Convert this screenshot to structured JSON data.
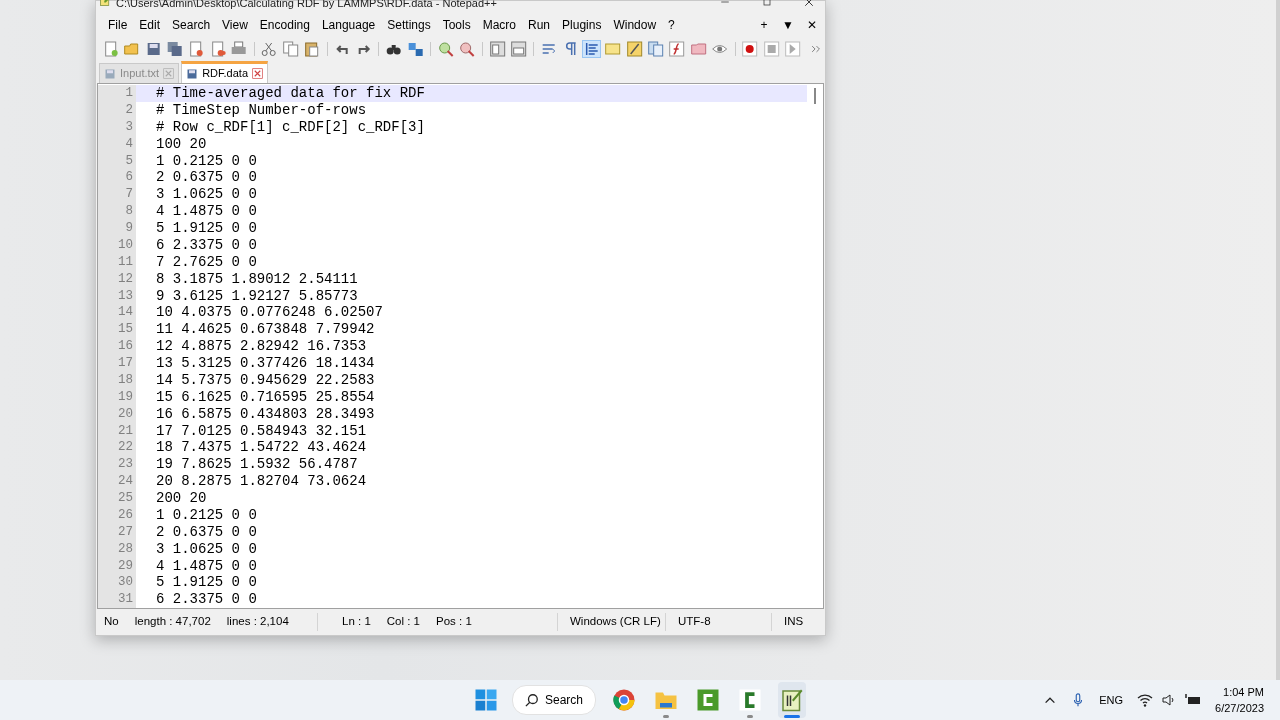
{
  "window": {
    "title": "C:\\Users\\Admin\\Desktop\\Calculating RDF by LAMMPS\\RDF.data - Notepad++",
    "menu": [
      "File",
      "Edit",
      "Search",
      "View",
      "Encoding",
      "Language",
      "Settings",
      "Tools",
      "Macro",
      "Run",
      "Plugins",
      "Window",
      "?"
    ],
    "menu_right": [
      "+",
      "▼",
      "✕"
    ]
  },
  "toolbar": {
    "indent_guide_on": true
  },
  "tabs": [
    {
      "label": "Input.txt",
      "selected": false
    },
    {
      "label": "RDF.data",
      "selected": true
    }
  ],
  "editor": {
    "lines": [
      {
        "number": "1",
        "text": "# Time-averaged data for fix RDF",
        "current": true
      },
      {
        "number": "2",
        "text": "# TimeStep Number-of-rows",
        "current": false
      },
      {
        "number": "3",
        "text": "# Row c_RDF[1] c_RDF[2] c_RDF[3]",
        "current": false
      },
      {
        "number": "4",
        "text": "100 20",
        "current": false
      },
      {
        "number": "5",
        "text": "1 0.2125 0 0",
        "current": false
      },
      {
        "number": "6",
        "text": "2 0.6375 0 0",
        "current": false
      },
      {
        "number": "7",
        "text": "3 1.0625 0 0",
        "current": false
      },
      {
        "number": "8",
        "text": "4 1.4875 0 0",
        "current": false
      },
      {
        "number": "9",
        "text": "5 1.9125 0 0",
        "current": false
      },
      {
        "number": "10",
        "text": "6 2.3375 0 0",
        "current": false
      },
      {
        "number": "11",
        "text": "7 2.7625 0 0",
        "current": false
      },
      {
        "number": "12",
        "text": "8 3.1875 1.89012 2.54111",
        "current": false
      },
      {
        "number": "13",
        "text": "9 3.6125 1.92127 5.85773",
        "current": false
      },
      {
        "number": "14",
        "text": "10 4.0375 0.0776248 6.02507",
        "current": false
      },
      {
        "number": "15",
        "text": "11 4.4625 0.673848 7.79942",
        "current": false
      },
      {
        "number": "16",
        "text": "12 4.8875 2.82942 16.7353",
        "current": false
      },
      {
        "number": "17",
        "text": "13 5.3125 0.377426 18.1434",
        "current": false
      },
      {
        "number": "18",
        "text": "14 5.7375 0.945629 22.2583",
        "current": false
      },
      {
        "number": "19",
        "text": "15 6.1625 0.716595 25.8554",
        "current": false
      },
      {
        "number": "20",
        "text": "16 6.5875 0.434803 28.3493",
        "current": false
      },
      {
        "number": "21",
        "text": "17 7.0125 0.584943 32.151",
        "current": false
      },
      {
        "number": "22",
        "text": "18 7.4375 1.54722 43.4624",
        "current": false
      },
      {
        "number": "23",
        "text": "19 7.8625 1.5932 56.4787",
        "current": false
      },
      {
        "number": "24",
        "text": "20 8.2875 1.82704 73.0624",
        "current": false
      },
      {
        "number": "25",
        "text": "200 20",
        "current": false
      },
      {
        "number": "26",
        "text": "1 0.2125 0 0",
        "current": false
      },
      {
        "number": "27",
        "text": "2 0.6375 0 0",
        "current": false
      },
      {
        "number": "28",
        "text": "3 1.0625 0 0",
        "current": false
      },
      {
        "number": "29",
        "text": "4 1.4875 0 0",
        "current": false
      },
      {
        "number": "30",
        "text": "5 1.9125 0 0",
        "current": false
      },
      {
        "number": "31",
        "text": "6 2.3375 0 0",
        "current": false
      }
    ]
  },
  "status_bar": [
    {
      "text": "No"
    },
    {
      "text": "length : 47,702"
    },
    {
      "text": "lines : 2,104"
    },
    {
      "text": "Ln : 1"
    },
    {
      "text": "Col : 1"
    },
    {
      "text": "Pos : 1"
    },
    {
      "text": "Windows (CR LF)"
    },
    {
      "text": "UTF-8"
    },
    {
      "text": "INS"
    }
  ],
  "taskbar": {
    "search": "Search",
    "apps": [
      {
        "kind": "browser",
        "running": false,
        "active": false
      },
      {
        "kind": "folder",
        "running": true,
        "active": false
      },
      {
        "kind": "recorder",
        "running": false,
        "active": false
      },
      {
        "kind": "editor",
        "running": true,
        "active": false
      },
      {
        "kind": "notepad",
        "running": true,
        "active": true
      }
    ]
  },
  "tray": {
    "language": "ENG",
    "time": "1:04 PM",
    "date": "6/27/2023"
  }
}
